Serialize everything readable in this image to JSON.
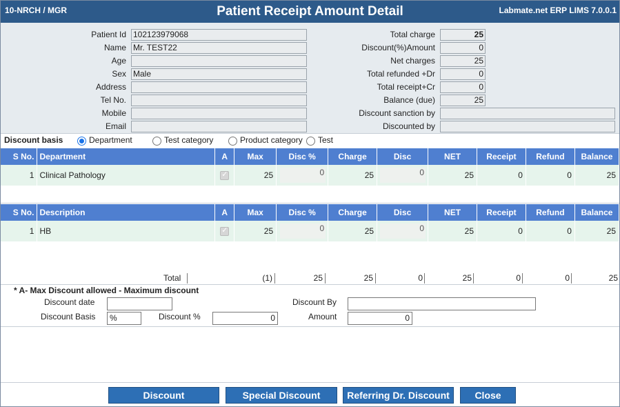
{
  "header": {
    "left": "10-NRCH / MGR",
    "title": "Patient Receipt Amount Detail",
    "right": "Labmate.net ERP LIMS 7.0.0.1"
  },
  "patient": {
    "labels": {
      "id": "Patient Id",
      "name": "Name",
      "age": "Age",
      "sex": "Sex",
      "address": "Address",
      "tel": "Tel No.",
      "mobile": "Mobile",
      "email": "Email"
    },
    "values": {
      "id": "102123979068",
      "name": "Mr. TEST22",
      "age": "",
      "sex": "Male",
      "address": "",
      "tel": "",
      "mobile": "",
      "email": ""
    }
  },
  "summary": {
    "labels": {
      "total_charge": "Total charge",
      "discount_amount": "Discount(%)Amount",
      "net_charges": "Net charges",
      "total_refunded": "Total refunded +Dr",
      "total_receipt": "Total receipt+Cr",
      "balance": "Balance (due)",
      "discount_sanction": "Discount sanction by",
      "discounted_by": "Discounted by"
    },
    "values": {
      "total_charge": "25",
      "discount_amount": "0",
      "net_charges": "25",
      "total_refunded": "0",
      "total_receipt": "0",
      "balance": "25",
      "discount_sanction": "",
      "discounted_by": ""
    }
  },
  "discount_basis": {
    "title": "Discount basis",
    "options": [
      "Department",
      "Test category",
      "Product category",
      "Test"
    ],
    "selected": "Department"
  },
  "dept_table": {
    "headers": [
      "S No.",
      "Department",
      "A",
      "Max",
      "Disc %",
      "Charge",
      "Disc",
      "NET",
      "Receipt",
      "Refund",
      "Balance"
    ],
    "rows": [
      {
        "sno": "1",
        "name": "Clinical Pathology",
        "max": "25",
        "disc_pct": "0",
        "charge": "25",
        "disc": "0",
        "net": "25",
        "receipt": "0",
        "refund": "0",
        "balance": "25"
      }
    ]
  },
  "test_table": {
    "headers": [
      "S No.",
      "Description",
      "A",
      "Max",
      "Disc %",
      "Charge",
      "Disc",
      "NET",
      "Receipt",
      "Refund",
      "Balance"
    ],
    "rows": [
      {
        "sno": "1",
        "name": "HB",
        "max": "25",
        "disc_pct": "0",
        "charge": "25",
        "disc": "0",
        "net": "25",
        "receipt": "0",
        "refund": "0",
        "balance": "25"
      }
    ]
  },
  "totals": {
    "label": "Total",
    "count": "(1)",
    "max": "25",
    "charge": "25",
    "disc": "0",
    "net": "25",
    "receipt": "0",
    "refund": "0",
    "balance": "25"
  },
  "discount_form": {
    "note": "* A- Max Discount allowed - Maximum discount",
    "date_label": "Discount date",
    "date_value": "",
    "by_label": "Discount By",
    "by_value": "",
    "basis_label": "Discount Basis",
    "basis_value": "%",
    "pct_label": "Discount %",
    "pct_value": "0",
    "amount_label": "Amount",
    "amount_value": "0"
  },
  "buttons": {
    "discount": "Discount",
    "special": "Special Discount",
    "referring": "Referring Dr.  Discount",
    "close": "Close"
  },
  "colors": {
    "title_bar": "#2d5a8a",
    "grid_header": "#4f7fd0",
    "grid_row": "#e6f4ec",
    "button": "#2d6fb5"
  }
}
